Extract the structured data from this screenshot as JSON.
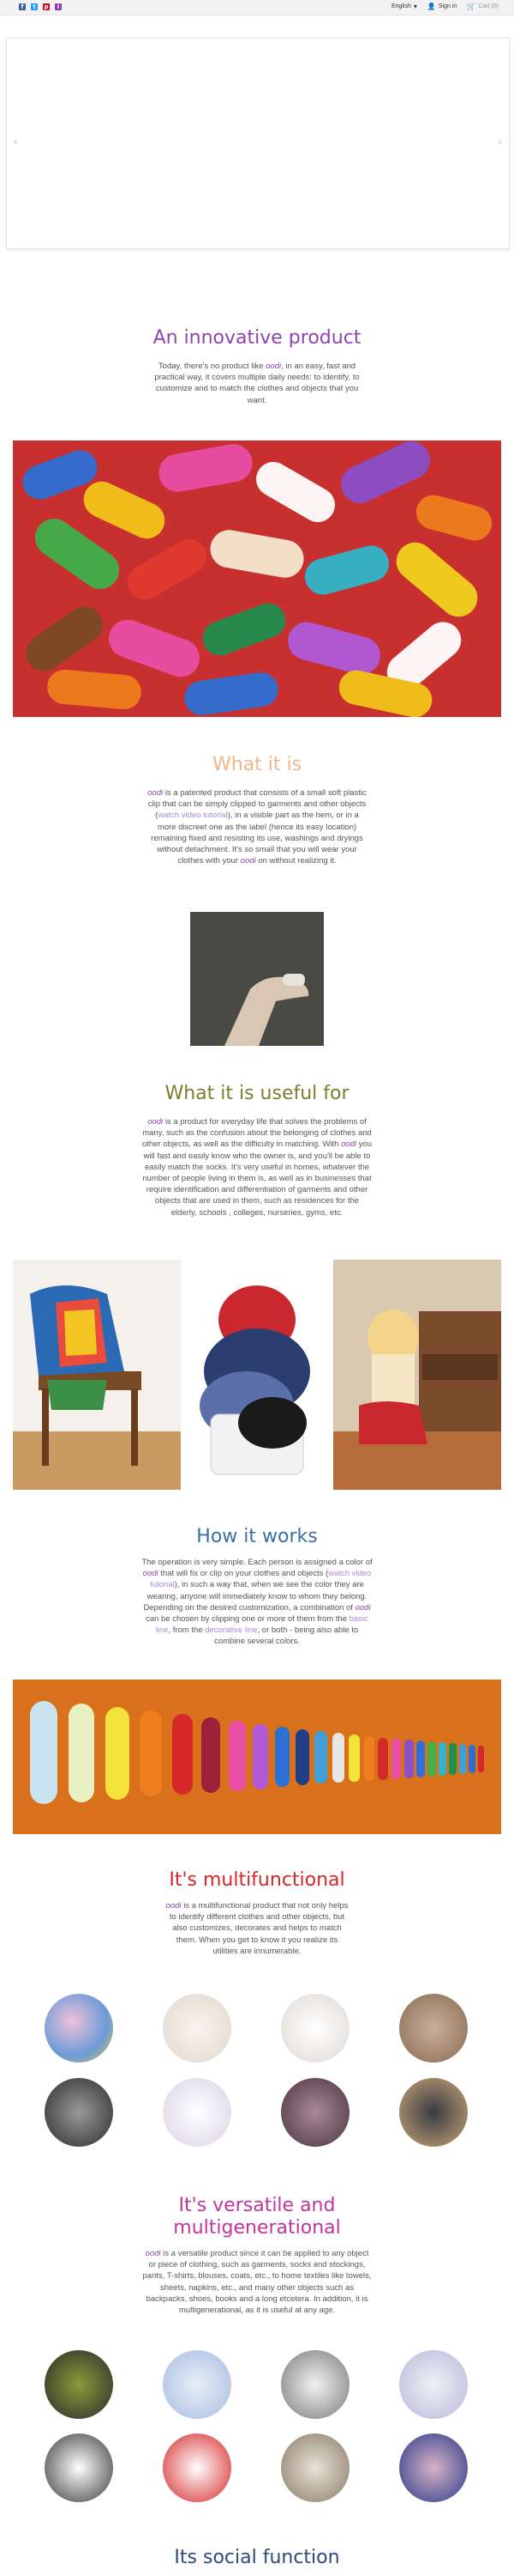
{
  "topbar": {
    "social": [
      "f",
      "t",
      "p",
      "i"
    ],
    "language": "English",
    "sign_in": "Sign in",
    "cart": "Cart (0)"
  },
  "colors": {
    "purple": "#8e44ad",
    "orange": "#f0b887",
    "olive": "#7a7f2e",
    "blue": "#3b6ea8",
    "red": "#d62828",
    "magenta": "#c0359e",
    "navy": "#2c4a7c"
  },
  "brand": "oodi",
  "sections": {
    "innovative": {
      "title": "An innovative product",
      "p1": "Today, there's no product like",
      "p2": ", in an easy, fast and practical way, it covers multiple daily needs: to identify, to customize and to match the clothes and objects that you want."
    },
    "what": {
      "title": "What it is",
      "p1": "is a patented product that consists of a small soft plastic clip that can be simply clipped to garments and other objects (",
      "link": "watch video tutorial",
      "p2": "), in a visible part as the hem, or in a more discreet one as the label (hence its easy location) remaining fixed and resisting its use, washings and dryings without detachment. It's so small that you will wear your clothes with your",
      "p3": "on without realizing it."
    },
    "useful": {
      "title": "What it is useful for",
      "p1": "is a product for everyday life that solves the problems of many, such as the confusion about the belonging of clothes and other objects, as well as the difficulty in matching. With",
      "p2": "you will fast and easily know who the owner is, and you'll be able to easily match the socks. It's very useful in homes, whatever the number of people living in them is, as well as in businesses that require identification and differentiation of garments and other objects that are used in them, such as residences for the elderly, schools , colleges, nurseries, gyms, etc."
    },
    "how": {
      "title": "How it works",
      "p1": "The operation is very simple. Each person is assigned a color of",
      "p2": "that will fix or clip on your clothes and objects (",
      "link": "watch video tutorial",
      "p3": "), in such a way that, when we see the color they are wearing, anyone will immediately know to whom they belong. Depending on the desired customization, a combination of",
      "p4": "can be chosen by clipping one or more of them from the",
      "link2": "basic line",
      "p5": ", from the",
      "link3": "decorative line",
      "p6": ", or both - being also able to combine several colors."
    },
    "multi": {
      "title": "It's multifunctional",
      "p1": "is a multifunctional product that not only helps to identify different clothes and other objects, but also customizes, decorates and helps to match them. When you get to know it you realize its utilities are innumerable."
    },
    "versatile": {
      "title_line1": "It's versatile and",
      "title_line2": "multigenerational",
      "p1": "is a versatile product since it can be applied to any object or piece of clothing, such as garments, socks and stockings, pants, T-shirts, blouses, coats, etc., to home textiles like towels, sheets, napkins, etc., and many other objects such as backpacks, shoes, books and a long etcetera. In addition, it is multigenerational, as it is useful at any age."
    },
    "social_fn": {
      "title": "Its social function"
    }
  }
}
